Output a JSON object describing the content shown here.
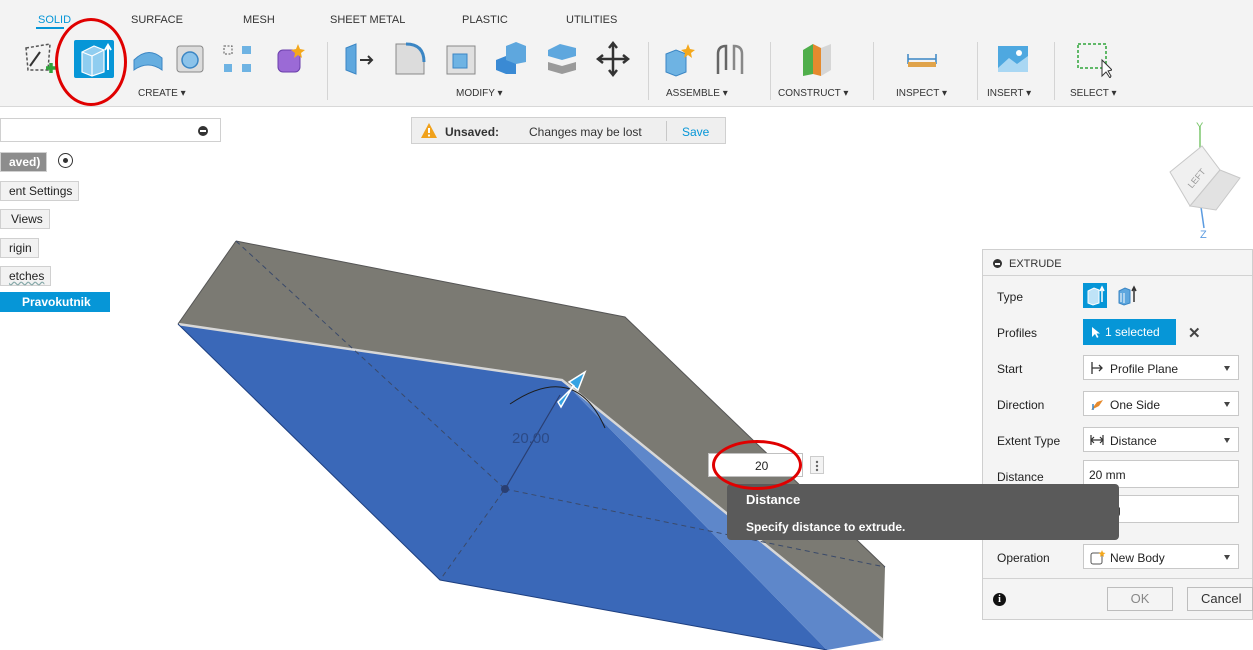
{
  "tabs": [
    {
      "label": "SOLID",
      "active": true
    },
    {
      "label": "SURFACE",
      "active": false
    },
    {
      "label": "MESH",
      "active": false
    },
    {
      "label": "SHEET METAL",
      "active": false
    },
    {
      "label": "PLASTIC",
      "active": false
    },
    {
      "label": "UTILITIES",
      "active": false
    }
  ],
  "toolbar_groups": [
    "CREATE ▾",
    "MODIFY ▾",
    "ASSEMBLE ▾",
    "CONSTRUCT ▾",
    "INSPECT ▾",
    "INSERT ▾",
    "SELECT ▾"
  ],
  "notification": {
    "label": "Unsaved:",
    "message": "Changes may be lost",
    "action": "Save"
  },
  "browser": {
    "document": "aved)",
    "items": [
      "ent Settings",
      "Views",
      "rigin",
      "etches"
    ],
    "sketch": "Pravokutnik"
  },
  "viewcube": {
    "face": "LEFT",
    "axis_y": "Y",
    "axis_z": "Z"
  },
  "canvas": {
    "dimension_label": "20.00",
    "distance_input": "20"
  },
  "tooltip": {
    "title": "Distance",
    "body": "Specify distance to extrude."
  },
  "extrude": {
    "title": "EXTRUDE",
    "rows": {
      "type": "Type",
      "profiles": "Profiles",
      "start": "Start",
      "direction": "Direction",
      "extent_type": "Extent Type",
      "distance": "Distance",
      "operation": "Operation"
    },
    "profiles_value": "1 selected",
    "start_value": "Profile Plane",
    "direction_value": "One Side",
    "extent_type_value": "Distance",
    "distance_value": "20 mm",
    "taper_value": "g",
    "operation_value": "New Body",
    "ok": "OK",
    "cancel": "Cancel"
  },
  "colors": {
    "accent": "#0696d7",
    "face_blue": "#3a68b8",
    "top_face": "#7b7a73",
    "annotation_red": "#e00000"
  }
}
